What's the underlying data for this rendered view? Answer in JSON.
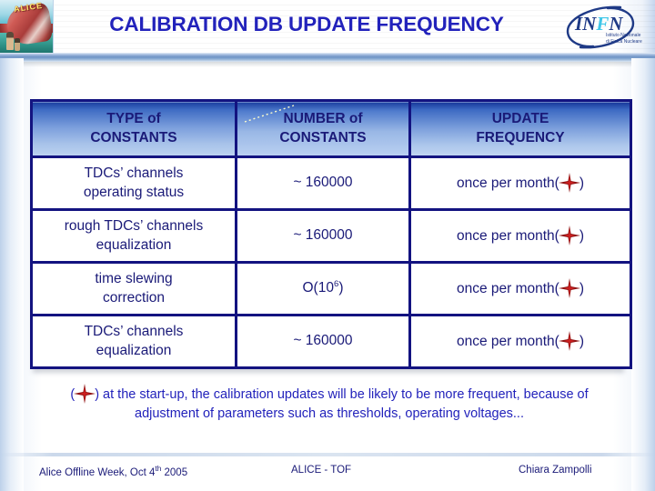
{
  "slide": {
    "title": "CALIBRATION DB UPDATE FREQUENCY"
  },
  "logos": {
    "alice": {
      "name": "alice-detector-logo",
      "word": "ALICE"
    },
    "infn": {
      "acronym_part1": "IN",
      "acronym_part2": "F",
      "acronym_part3": "N",
      "subtitle_line1": "Istituto Nazionale",
      "subtitle_line2": "di Fisica Nucleare"
    }
  },
  "table": {
    "headers": [
      {
        "line1": "TYPE of",
        "line2": "CONSTANTS"
      },
      {
        "line1": "NUMBER of",
        "line2": "CONSTANTS"
      },
      {
        "line1": "UPDATE",
        "line2": "FREQUENCY"
      }
    ],
    "rows": [
      {
        "type_line1": "TDCs’ channels",
        "type_line2": "operating status",
        "number": "~ 160000",
        "number_sup": "",
        "frequency_prefix": "once per month(",
        "frequency_suffix": ")"
      },
      {
        "type_line1": "rough TDCs’ channels",
        "type_line2": "equalization",
        "number": "~ 160000",
        "number_sup": "",
        "frequency_prefix": "once per month(",
        "frequency_suffix": ")"
      },
      {
        "type_line1": "time slewing",
        "type_line2": "correction",
        "number": "O(10",
        "number_sup": "6",
        "number_tail": ")",
        "frequency_prefix": "once per month(",
        "frequency_suffix": ")"
      },
      {
        "type_line1": "TDCs’ channels",
        "type_line2": "equalization",
        "number": "~ 160000",
        "number_sup": "",
        "frequency_prefix": "once per month(",
        "frequency_suffix": ")"
      }
    ]
  },
  "footnote": {
    "prefix": "(",
    "suffix": ") at the start-up, the calibration updates will be likely to be more frequent, because of adjustment of parameters such as thresholds, operating voltages..."
  },
  "footer": {
    "left_pre": "Alice Offline Week, Oct 4",
    "left_sup": "th",
    "left_post": " 2005",
    "middle": "ALICE - TOF",
    "right": "Chiara Zampolli"
  },
  "colors": {
    "title_blue": "#2222bb",
    "table_border_navy": "#131380",
    "table_text_navy": "#1a1a78",
    "star_red": "#8f1212",
    "header_gradient_top": "#1b3fa0",
    "header_gradient_bottom": "#bcd2f0"
  }
}
